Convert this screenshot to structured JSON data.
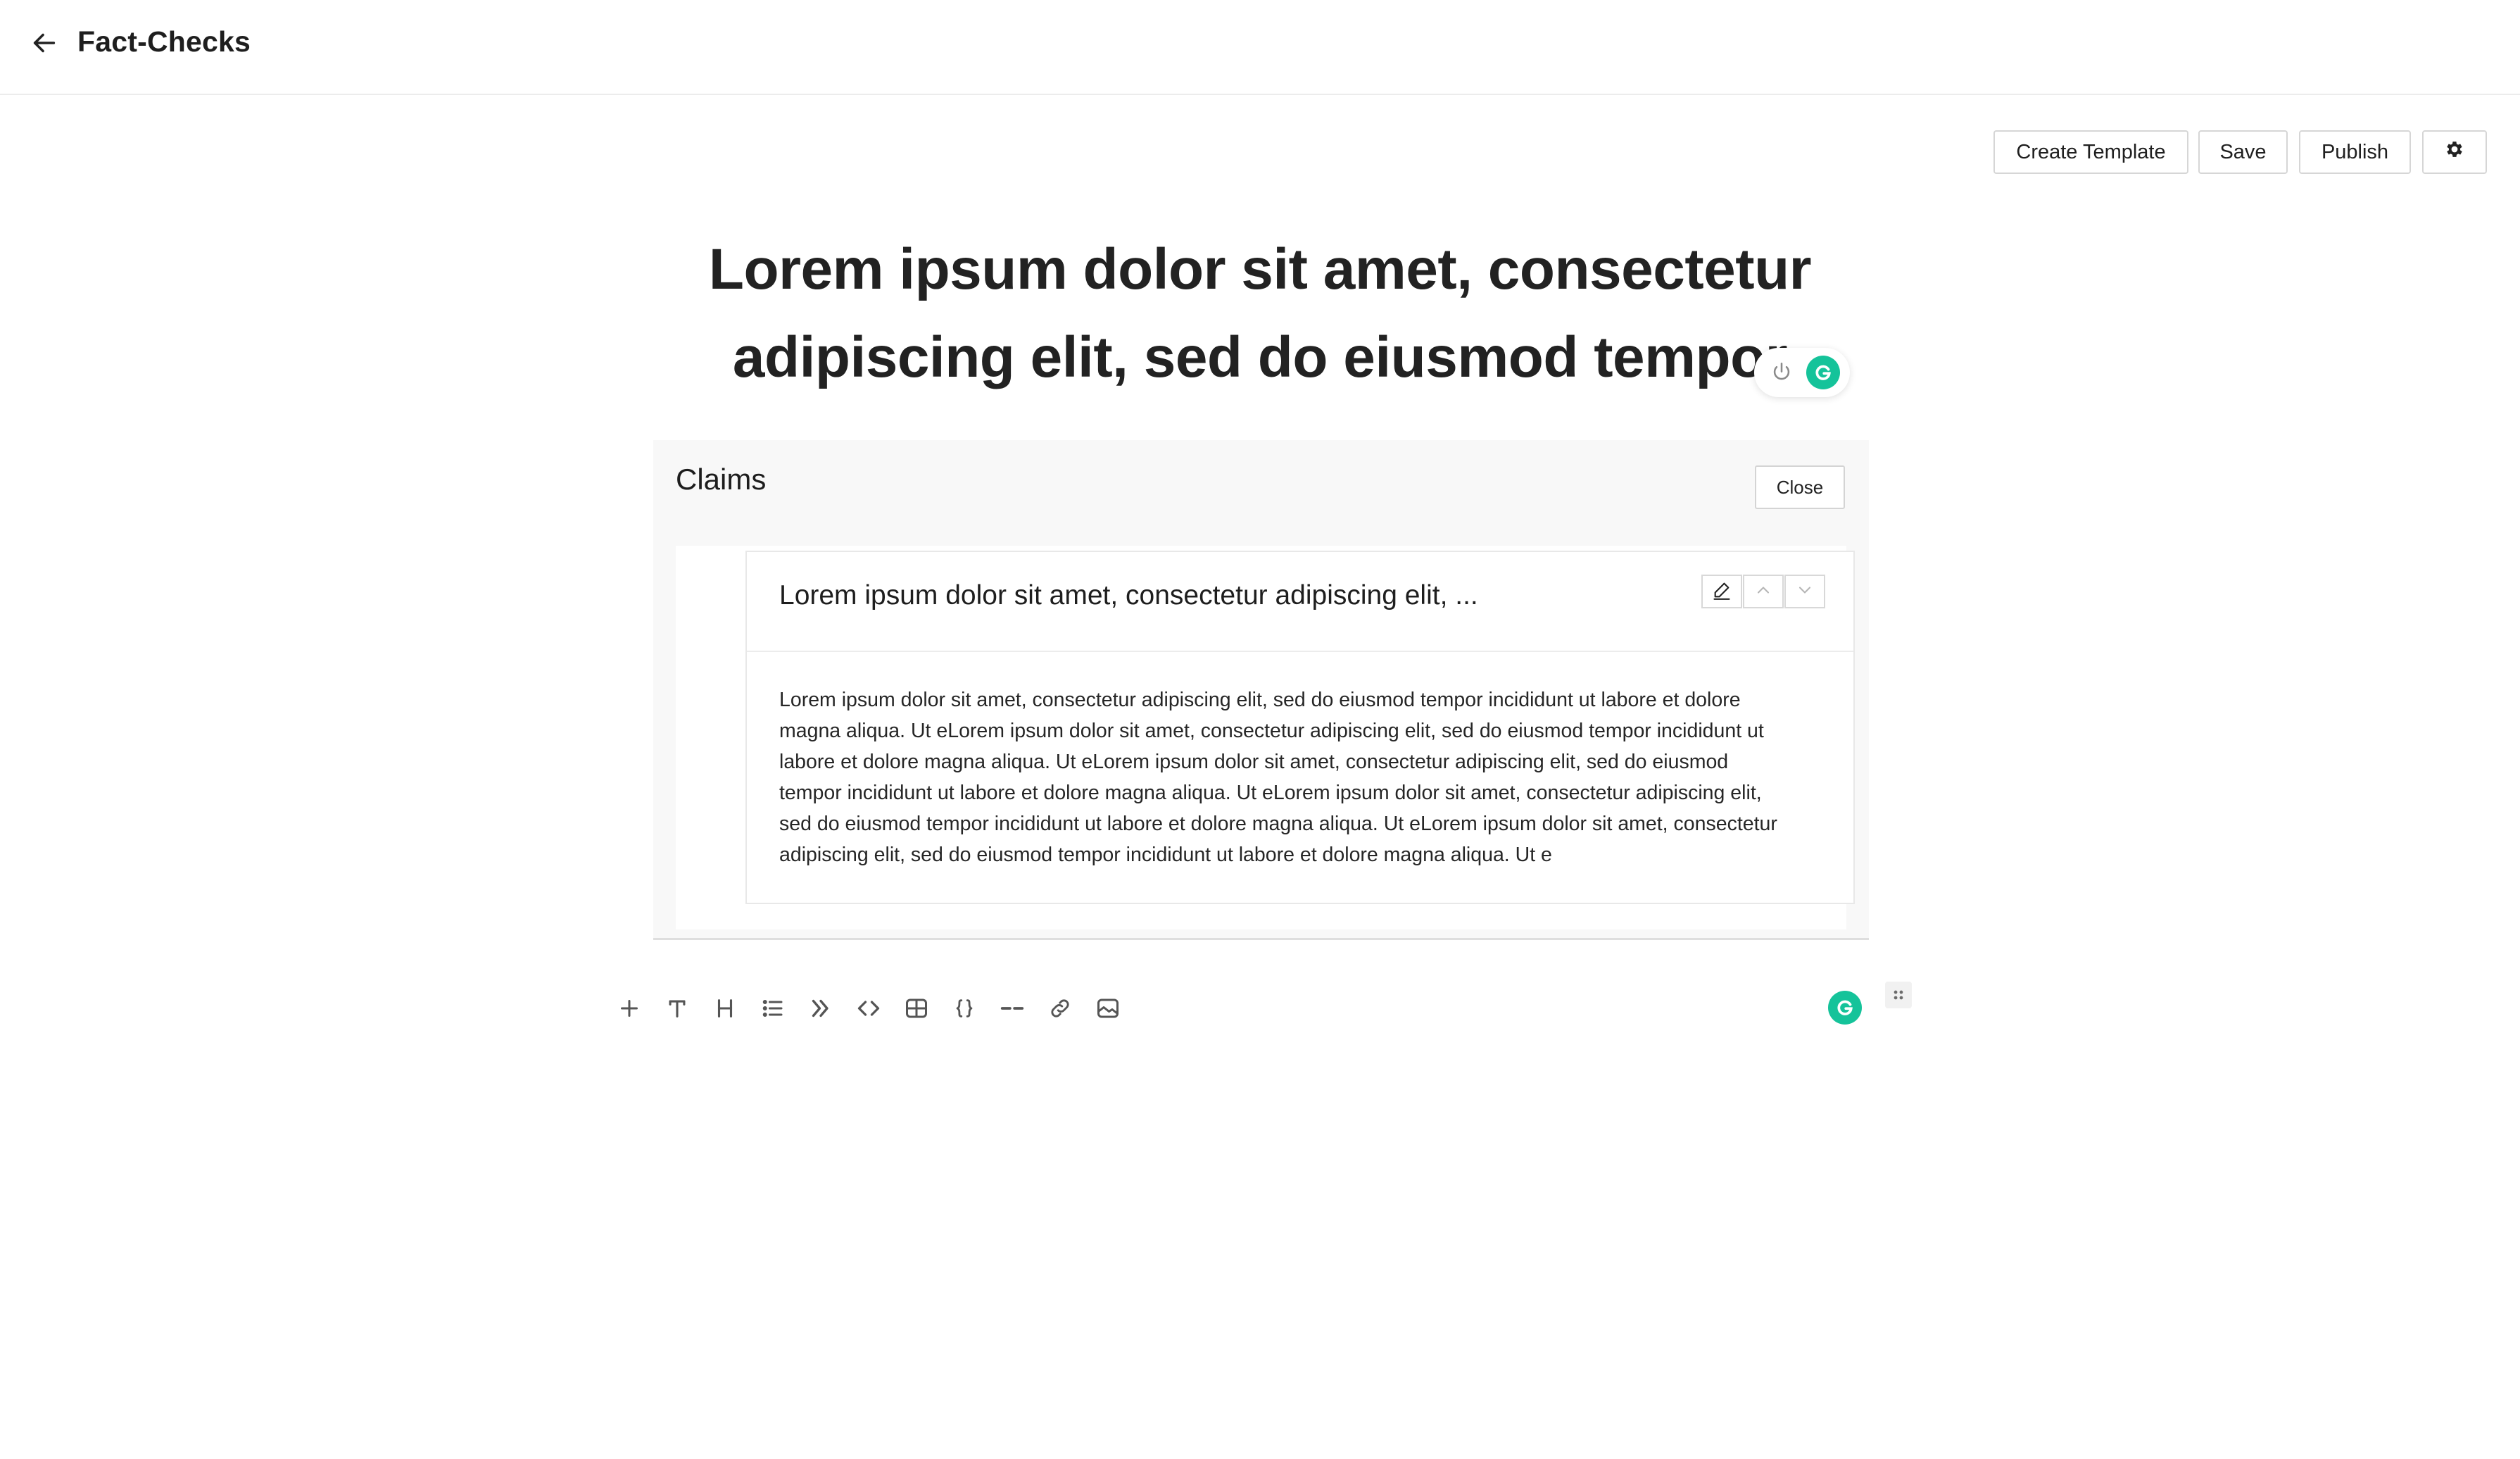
{
  "header": {
    "title": "Fact-Checks",
    "back_icon": "arrow-left-icon"
  },
  "toolbar": {
    "create_template_label": "Create Template",
    "save_label": "Save",
    "publish_label": "Publish",
    "settings_icon": "gear-icon"
  },
  "document": {
    "title_line1": "Lorem ipsum dolor sit amet, consectetur",
    "title_line2": "adipiscing elit, sed do eiusmod tempor"
  },
  "claims": {
    "heading": "Claims",
    "close_label": "Close",
    "items": [
      {
        "title": "Lorem ipsum dolor sit amet, consectetur adipiscing elit, ...",
        "body_lines": [
          "Lorem ipsum dolor sit amet, consectetur adipiscing elit, sed do eiusmod tempor incididunt ut labore et dolore",
          "magna aliqua. Ut eLorem ipsum dolor sit amet, consectetur adipiscing elit, sed do eiusmod tempor incididunt ut",
          "labore et dolore magna aliqua. Ut eLorem ipsum dolor sit amet, consectetur adipiscing elit, sed do eiusmod",
          "tempor incididunt ut labore et dolore magna aliqua. Ut eLorem ipsum dolor sit amet, consectetur adipiscing elit,",
          "sed do eiusmod tempor incididunt ut labore et dolore magna aliqua. Ut eLorem ipsum dolor sit amet, consectetur",
          "adipiscing elit, sed do eiusmod tempor incididunt ut labore et dolore magna aliqua. Ut e"
        ]
      }
    ]
  },
  "block_toolbar": {
    "tools": [
      "plus-icon",
      "text-icon",
      "heading-icon",
      "list-icon",
      "quote-icon",
      "code-icon",
      "table-icon",
      "code-block-icon",
      "divider-icon",
      "link-icon",
      "image-icon"
    ]
  },
  "colors": {
    "grammarly_green": "#15c39a",
    "border": "#d6d6d6",
    "panel_bg": "#f8f8f8"
  }
}
